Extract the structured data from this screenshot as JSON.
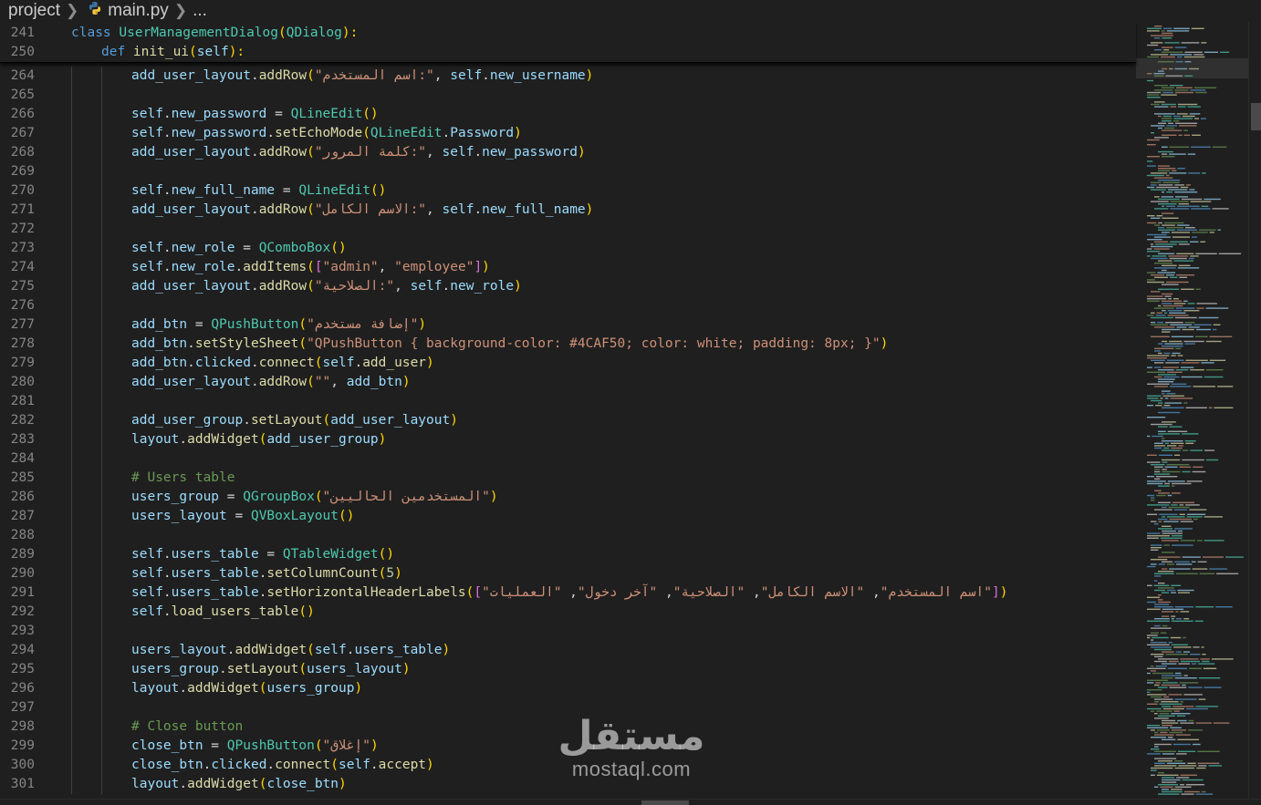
{
  "breadcrumb": {
    "folder": "project",
    "file": "main.py",
    "more": "...",
    "file_icon": "python-icon"
  },
  "sticky_lines": [
    {
      "num": "241",
      "indent": 0,
      "tokens": [
        [
          "kw",
          "class "
        ],
        [
          "cls",
          "UserManagementDialog"
        ],
        [
          "p1",
          "("
        ],
        [
          "cls",
          "QDialog"
        ],
        [
          "p1",
          "):"
        ]
      ]
    },
    {
      "num": "250",
      "indent": 1,
      "tokens": [
        [
          "kw",
          "def "
        ],
        [
          "fn",
          "init_ui"
        ],
        [
          "p1",
          "("
        ],
        [
          "self",
          "self"
        ],
        [
          "p1",
          "):"
        ]
      ]
    }
  ],
  "lines": [
    {
      "num": "264",
      "indent": 2,
      "tokens": [
        [
          "var",
          "add_user_layout"
        ],
        [
          "plain",
          "."
        ],
        [
          "fn",
          "addRow"
        ],
        [
          "p1",
          "("
        ],
        [
          "str",
          "\"اسم المستخدم:\""
        ],
        [
          "plain",
          ", "
        ],
        [
          "self",
          "self"
        ],
        [
          "plain",
          "."
        ],
        [
          "var",
          "new_username"
        ],
        [
          "p1",
          ")"
        ]
      ]
    },
    {
      "num": "265",
      "indent": 2,
      "tokens": []
    },
    {
      "num": "266",
      "indent": 2,
      "tokens": [
        [
          "self",
          "self"
        ],
        [
          "plain",
          "."
        ],
        [
          "var",
          "new_password"
        ],
        [
          "plain",
          " = "
        ],
        [
          "cls",
          "QLineEdit"
        ],
        [
          "p1",
          "()"
        ]
      ]
    },
    {
      "num": "267",
      "indent": 2,
      "tokens": [
        [
          "self",
          "self"
        ],
        [
          "plain",
          "."
        ],
        [
          "var",
          "new_password"
        ],
        [
          "plain",
          "."
        ],
        [
          "fn",
          "setEchoMode"
        ],
        [
          "p1",
          "("
        ],
        [
          "cls",
          "QLineEdit"
        ],
        [
          "plain",
          "."
        ],
        [
          "var",
          "Password"
        ],
        [
          "p1",
          ")"
        ]
      ]
    },
    {
      "num": "268",
      "indent": 2,
      "tokens": [
        [
          "var",
          "add_user_layout"
        ],
        [
          "plain",
          "."
        ],
        [
          "fn",
          "addRow"
        ],
        [
          "p1",
          "("
        ],
        [
          "str",
          "\"كلمة المرور:\""
        ],
        [
          "plain",
          ", "
        ],
        [
          "self",
          "self"
        ],
        [
          "plain",
          "."
        ],
        [
          "var",
          "new_password"
        ],
        [
          "p1",
          ")"
        ]
      ]
    },
    {
      "num": "269",
      "indent": 2,
      "tokens": []
    },
    {
      "num": "270",
      "indent": 2,
      "tokens": [
        [
          "self",
          "self"
        ],
        [
          "plain",
          "."
        ],
        [
          "var",
          "new_full_name"
        ],
        [
          "plain",
          " = "
        ],
        [
          "cls",
          "QLineEdit"
        ],
        [
          "p1",
          "()"
        ]
      ]
    },
    {
      "num": "271",
      "indent": 2,
      "tokens": [
        [
          "var",
          "add_user_layout"
        ],
        [
          "plain",
          "."
        ],
        [
          "fn",
          "addRow"
        ],
        [
          "p1",
          "("
        ],
        [
          "str",
          "\"الاسم الكامل:\""
        ],
        [
          "plain",
          ", "
        ],
        [
          "self",
          "self"
        ],
        [
          "plain",
          "."
        ],
        [
          "var",
          "new_full_name"
        ],
        [
          "p1",
          ")"
        ]
      ]
    },
    {
      "num": "272",
      "indent": 2,
      "tokens": []
    },
    {
      "num": "273",
      "indent": 2,
      "tokens": [
        [
          "self",
          "self"
        ],
        [
          "plain",
          "."
        ],
        [
          "var",
          "new_role"
        ],
        [
          "plain",
          " = "
        ],
        [
          "cls",
          "QComboBox"
        ],
        [
          "p1",
          "()"
        ]
      ]
    },
    {
      "num": "274",
      "indent": 2,
      "tokens": [
        [
          "self",
          "self"
        ],
        [
          "plain",
          "."
        ],
        [
          "var",
          "new_role"
        ],
        [
          "plain",
          "."
        ],
        [
          "fn",
          "addItems"
        ],
        [
          "p1",
          "("
        ],
        [
          "p2",
          "["
        ],
        [
          "str",
          "\"admin\""
        ],
        [
          "plain",
          ", "
        ],
        [
          "str",
          "\"employee\""
        ],
        [
          "p2",
          "]"
        ],
        [
          "p1",
          ")"
        ]
      ]
    },
    {
      "num": "275",
      "indent": 2,
      "tokens": [
        [
          "var",
          "add_user_layout"
        ],
        [
          "plain",
          "."
        ],
        [
          "fn",
          "addRow"
        ],
        [
          "p1",
          "("
        ],
        [
          "str",
          "\"الصلاحية:\""
        ],
        [
          "plain",
          ", "
        ],
        [
          "self",
          "self"
        ],
        [
          "plain",
          "."
        ],
        [
          "var",
          "new_role"
        ],
        [
          "p1",
          ")"
        ]
      ]
    },
    {
      "num": "276",
      "indent": 2,
      "tokens": []
    },
    {
      "num": "277",
      "indent": 2,
      "tokens": [
        [
          "var",
          "add_btn"
        ],
        [
          "plain",
          " = "
        ],
        [
          "cls",
          "QPushButton"
        ],
        [
          "p1",
          "("
        ],
        [
          "str",
          "\"إضافة مستخدم\""
        ],
        [
          "p1",
          ")"
        ]
      ]
    },
    {
      "num": "278",
      "indent": 2,
      "tokens": [
        [
          "var",
          "add_btn"
        ],
        [
          "plain",
          "."
        ],
        [
          "fn",
          "setStyleSheet"
        ],
        [
          "p1",
          "("
        ],
        [
          "str",
          "\"QPushButton { background-color: #4CAF50; color: white; padding: 8px; }\""
        ],
        [
          "p1",
          ")"
        ]
      ]
    },
    {
      "num": "279",
      "indent": 2,
      "tokens": [
        [
          "var",
          "add_btn"
        ],
        [
          "plain",
          "."
        ],
        [
          "var",
          "clicked"
        ],
        [
          "plain",
          "."
        ],
        [
          "fn",
          "connect"
        ],
        [
          "p1",
          "("
        ],
        [
          "self",
          "self"
        ],
        [
          "plain",
          "."
        ],
        [
          "fn",
          "add_user"
        ],
        [
          "p1",
          ")"
        ]
      ]
    },
    {
      "num": "280",
      "indent": 2,
      "tokens": [
        [
          "var",
          "add_user_layout"
        ],
        [
          "plain",
          "."
        ],
        [
          "fn",
          "addRow"
        ],
        [
          "p1",
          "("
        ],
        [
          "str",
          "\"\""
        ],
        [
          "plain",
          ", "
        ],
        [
          "var",
          "add_btn"
        ],
        [
          "p1",
          ")"
        ]
      ]
    },
    {
      "num": "281",
      "indent": 2,
      "tokens": []
    },
    {
      "num": "282",
      "indent": 2,
      "tokens": [
        [
          "var",
          "add_user_group"
        ],
        [
          "plain",
          "."
        ],
        [
          "fn",
          "setLayout"
        ],
        [
          "p1",
          "("
        ],
        [
          "var",
          "add_user_layout"
        ],
        [
          "p1",
          ")"
        ]
      ]
    },
    {
      "num": "283",
      "indent": 2,
      "tokens": [
        [
          "var",
          "layout"
        ],
        [
          "plain",
          "."
        ],
        [
          "fn",
          "addWidget"
        ],
        [
          "p1",
          "("
        ],
        [
          "var",
          "add_user_group"
        ],
        [
          "p1",
          ")"
        ]
      ]
    },
    {
      "num": "284",
      "indent": 2,
      "tokens": []
    },
    {
      "num": "285",
      "indent": 2,
      "tokens": [
        [
          "cmt",
          "# Users table"
        ]
      ]
    },
    {
      "num": "286",
      "indent": 2,
      "tokens": [
        [
          "var",
          "users_group"
        ],
        [
          "plain",
          " = "
        ],
        [
          "cls",
          "QGroupBox"
        ],
        [
          "p1",
          "("
        ],
        [
          "str",
          "\"المستخدمين الحاليين\""
        ],
        [
          "p1",
          ")"
        ]
      ]
    },
    {
      "num": "287",
      "indent": 2,
      "tokens": [
        [
          "var",
          "users_layout"
        ],
        [
          "plain",
          " = "
        ],
        [
          "cls",
          "QVBoxLayout"
        ],
        [
          "p1",
          "()"
        ]
      ]
    },
    {
      "num": "288",
      "indent": 2,
      "tokens": []
    },
    {
      "num": "289",
      "indent": 2,
      "tokens": [
        [
          "self",
          "self"
        ],
        [
          "plain",
          "."
        ],
        [
          "var",
          "users_table"
        ],
        [
          "plain",
          " = "
        ],
        [
          "cls",
          "QTableWidget"
        ],
        [
          "p1",
          "()"
        ]
      ]
    },
    {
      "num": "290",
      "indent": 2,
      "tokens": [
        [
          "self",
          "self"
        ],
        [
          "plain",
          "."
        ],
        [
          "var",
          "users_table"
        ],
        [
          "plain",
          "."
        ],
        [
          "fn",
          "setColumnCount"
        ],
        [
          "p1",
          "("
        ],
        [
          "num",
          "5"
        ],
        [
          "p1",
          ")"
        ]
      ]
    },
    {
      "num": "291",
      "indent": 2,
      "tokens": [
        [
          "self",
          "self"
        ],
        [
          "plain",
          "."
        ],
        [
          "var",
          "users_table"
        ],
        [
          "plain",
          "."
        ],
        [
          "fn",
          "setHorizontalHeaderLabels"
        ],
        [
          "p1",
          "("
        ],
        [
          "p2",
          "["
        ],
        [
          "str",
          "\"اسم المستخدم\""
        ],
        [
          "plain",
          ", "
        ],
        [
          "str",
          "\"الاسم الكامل\""
        ],
        [
          "plain",
          ", "
        ],
        [
          "str",
          "\"الصلاحية\""
        ],
        [
          "plain",
          ", "
        ],
        [
          "str",
          "\"آخر دخول\""
        ],
        [
          "plain",
          ", "
        ],
        [
          "str",
          "\"العمليات\""
        ],
        [
          "p2",
          "]"
        ],
        [
          "p1",
          ")"
        ]
      ]
    },
    {
      "num": "292",
      "indent": 2,
      "tokens": [
        [
          "self",
          "self"
        ],
        [
          "plain",
          "."
        ],
        [
          "fn",
          "load_users_table"
        ],
        [
          "p1",
          "()"
        ]
      ]
    },
    {
      "num": "293",
      "indent": 2,
      "tokens": []
    },
    {
      "num": "294",
      "indent": 2,
      "tokens": [
        [
          "var",
          "users_layout"
        ],
        [
          "plain",
          "."
        ],
        [
          "fn",
          "addWidget"
        ],
        [
          "p1",
          "("
        ],
        [
          "self",
          "self"
        ],
        [
          "plain",
          "."
        ],
        [
          "var",
          "users_table"
        ],
        [
          "p1",
          ")"
        ]
      ]
    },
    {
      "num": "295",
      "indent": 2,
      "tokens": [
        [
          "var",
          "users_group"
        ],
        [
          "plain",
          "."
        ],
        [
          "fn",
          "setLayout"
        ],
        [
          "p1",
          "("
        ],
        [
          "var",
          "users_layout"
        ],
        [
          "p1",
          ")"
        ]
      ]
    },
    {
      "num": "296",
      "indent": 2,
      "tokens": [
        [
          "var",
          "layout"
        ],
        [
          "plain",
          "."
        ],
        [
          "fn",
          "addWidget"
        ],
        [
          "p1",
          "("
        ],
        [
          "var",
          "users_group"
        ],
        [
          "p1",
          ")"
        ]
      ]
    },
    {
      "num": "297",
      "indent": 2,
      "tokens": []
    },
    {
      "num": "298",
      "indent": 2,
      "tokens": [
        [
          "cmt",
          "# Close button"
        ]
      ]
    },
    {
      "num": "299",
      "indent": 2,
      "tokens": [
        [
          "var",
          "close_btn"
        ],
        [
          "plain",
          " = "
        ],
        [
          "cls",
          "QPushButton"
        ],
        [
          "p1",
          "("
        ],
        [
          "str",
          "\"إغلاق\""
        ],
        [
          "p1",
          ")"
        ]
      ]
    },
    {
      "num": "300",
      "indent": 2,
      "tokens": [
        [
          "var",
          "close_btn"
        ],
        [
          "plain",
          "."
        ],
        [
          "var",
          "clicked"
        ],
        [
          "plain",
          "."
        ],
        [
          "fn",
          "connect"
        ],
        [
          "p1",
          "("
        ],
        [
          "self",
          "self"
        ],
        [
          "plain",
          "."
        ],
        [
          "fn",
          "accept"
        ],
        [
          "p1",
          ")"
        ]
      ]
    },
    {
      "num": "301",
      "indent": 2,
      "tokens": [
        [
          "var",
          "layout"
        ],
        [
          "plain",
          "."
        ],
        [
          "fn",
          "addWidget"
        ],
        [
          "p1",
          "("
        ],
        [
          "var",
          "close_btn"
        ],
        [
          "p1",
          ")"
        ]
      ]
    }
  ],
  "watermark": {
    "arabic": "مستقل",
    "latin": "mostaql.com"
  },
  "colors": {
    "background": "#1f1f1f",
    "keyword": "#569cd6",
    "class": "#4ec9b0",
    "function": "#dcdcaa",
    "variable": "#9cdcfe",
    "string": "#ce9178",
    "comment": "#6a9955",
    "bracket": "#ffd700"
  }
}
